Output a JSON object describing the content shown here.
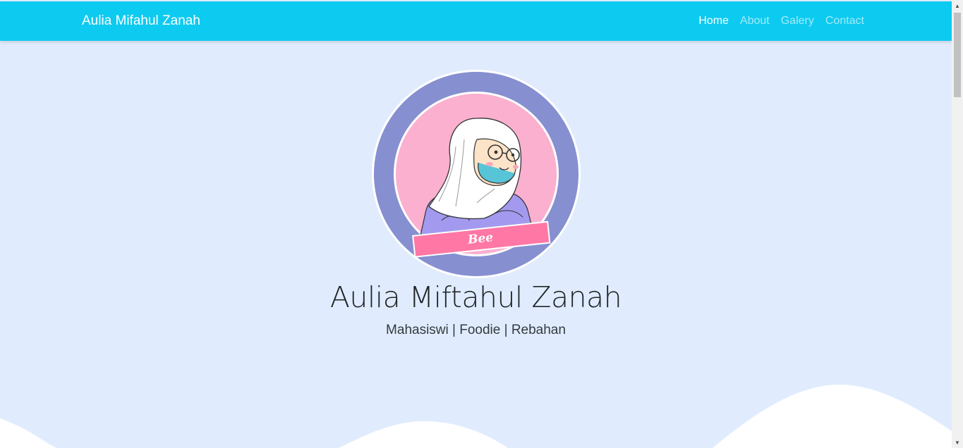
{
  "navbar": {
    "brand": "Aulia Mifahul Zanah",
    "links": [
      {
        "label": "Home",
        "active": true
      },
      {
        "label": "About",
        "active": false
      },
      {
        "label": "Galery",
        "active": false
      },
      {
        "label": "Contact",
        "active": false
      }
    ]
  },
  "hero": {
    "avatar_caption": "Bee",
    "name": "Aulia Miftahul Zanah",
    "tagline": "Mahasiswi | Foodie | Rebahan"
  },
  "colors": {
    "navbar": "#0dcaf0",
    "background": "#e0ecfd",
    "wave": "#ffffff",
    "avatar_ring": "#868fd0",
    "avatar_inner": "#fbb0d0",
    "caption_banner": "#ff77a5"
  }
}
